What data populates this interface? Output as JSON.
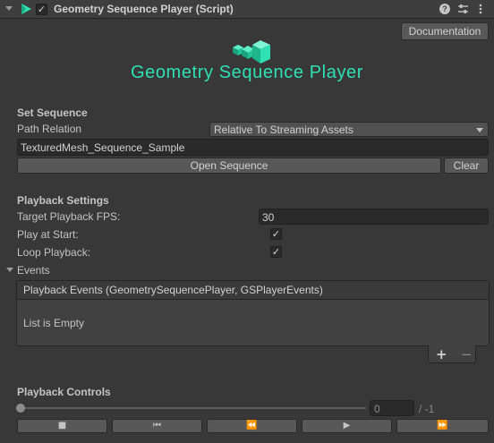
{
  "header": {
    "title": "Geometry Sequence Player (Script)",
    "play_icon": "play-icon",
    "help_icon": "help-icon",
    "settings_icon": "sliders-icon",
    "menu_icon": "kebab-menu-icon"
  },
  "documentation_label": "Documentation",
  "logo_text": "Geometry Sequence Player",
  "set_sequence": {
    "heading": "Set Sequence",
    "path_relation_label": "Path Relation",
    "path_relation_value": "Relative To Streaming Assets",
    "path_value": "TexturedMesh_Sequence_Sample",
    "open_label": "Open Sequence",
    "clear_label": "Clear"
  },
  "playback_settings": {
    "heading": "Playback Settings",
    "fps_label": "Target Playback FPS:",
    "fps_value": "30",
    "play_at_start_label": "Play at Start:",
    "play_at_start": true,
    "loop_label": "Loop Playback:",
    "loop": true
  },
  "events": {
    "heading": "Events",
    "list_title": "Playback Events (GeometrySequencePlayer, GSPlayerEvents)",
    "empty_text": "List is Empty",
    "add_label": "+",
    "remove_label": "−"
  },
  "playback_controls": {
    "heading": "Playback Controls",
    "frame_value": "0",
    "frame_total": "/ -1",
    "buttons": [
      "■",
      "⏮",
      "⏪",
      "▶",
      "⏩"
    ]
  },
  "colors": {
    "accent_logo": "#2fe0b4",
    "play_icon": "#2fe0b4",
    "background": "#383838"
  }
}
